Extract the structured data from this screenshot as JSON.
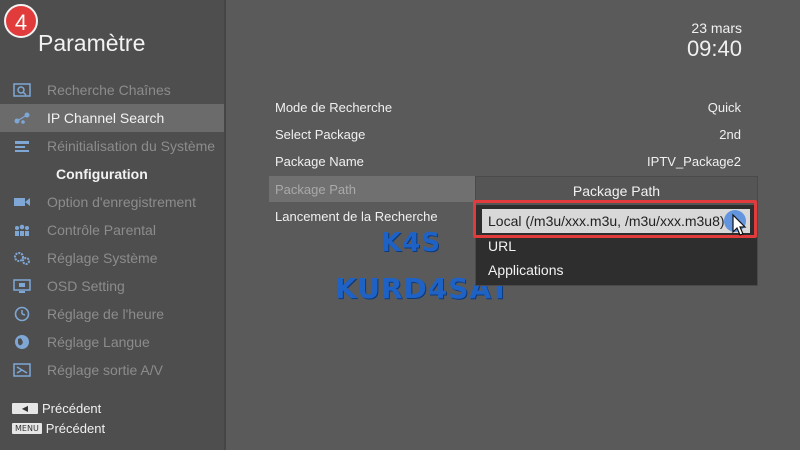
{
  "step_badge": "4",
  "sidebar": {
    "title": "Paramètre",
    "items": [
      {
        "label": "Recherche Chaînes",
        "icon": "search-channels-icon"
      },
      {
        "label": "IP Channel Search",
        "icon": "network-icon"
      },
      {
        "label": "Réinitialisation du Système",
        "icon": "reset-icon"
      },
      {
        "label": "Configuration",
        "icon": ""
      },
      {
        "label": "Option d'enregistrement",
        "icon": "record-icon"
      },
      {
        "label": "Contrôle Parental",
        "icon": "parental-icon"
      },
      {
        "label": "Réglage Système",
        "icon": "gears-icon"
      },
      {
        "label": "OSD Setting",
        "icon": "osd-icon"
      },
      {
        "label": "Réglage de l'heure",
        "icon": "clock-icon"
      },
      {
        "label": "Réglage Langue",
        "icon": "globe-icon"
      },
      {
        "label": "Réglage sortie A/V",
        "icon": "av-output-icon"
      }
    ],
    "active_index": 1,
    "footer": [
      {
        "key": "◀",
        "label": "Précédent"
      },
      {
        "key": "MENU",
        "label": "Précédent"
      }
    ]
  },
  "clock": {
    "date": "23 mars",
    "time": "09:40"
  },
  "settings": [
    {
      "label": "Mode de Recherche",
      "value": "Quick"
    },
    {
      "label": "Select Package",
      "value": "2nd"
    },
    {
      "label": "Package Name",
      "value": "IPTV_Package2"
    },
    {
      "label": "Package Path",
      "value": ""
    },
    {
      "label": "Lancement de la Recherche",
      "value": ""
    }
  ],
  "dropdown": {
    "title": "Package Path",
    "options": [
      "Local (/m3u/xxx.m3u, /m3u/xxx.m3u8)",
      "URL",
      "Applications"
    ],
    "selected_index": 0
  },
  "watermark": {
    "line1": "K4S",
    "line2": "KURD4SAT"
  },
  "colors": {
    "accent_red": "#e23b3b",
    "watermark_blue": "#1e62c6"
  }
}
